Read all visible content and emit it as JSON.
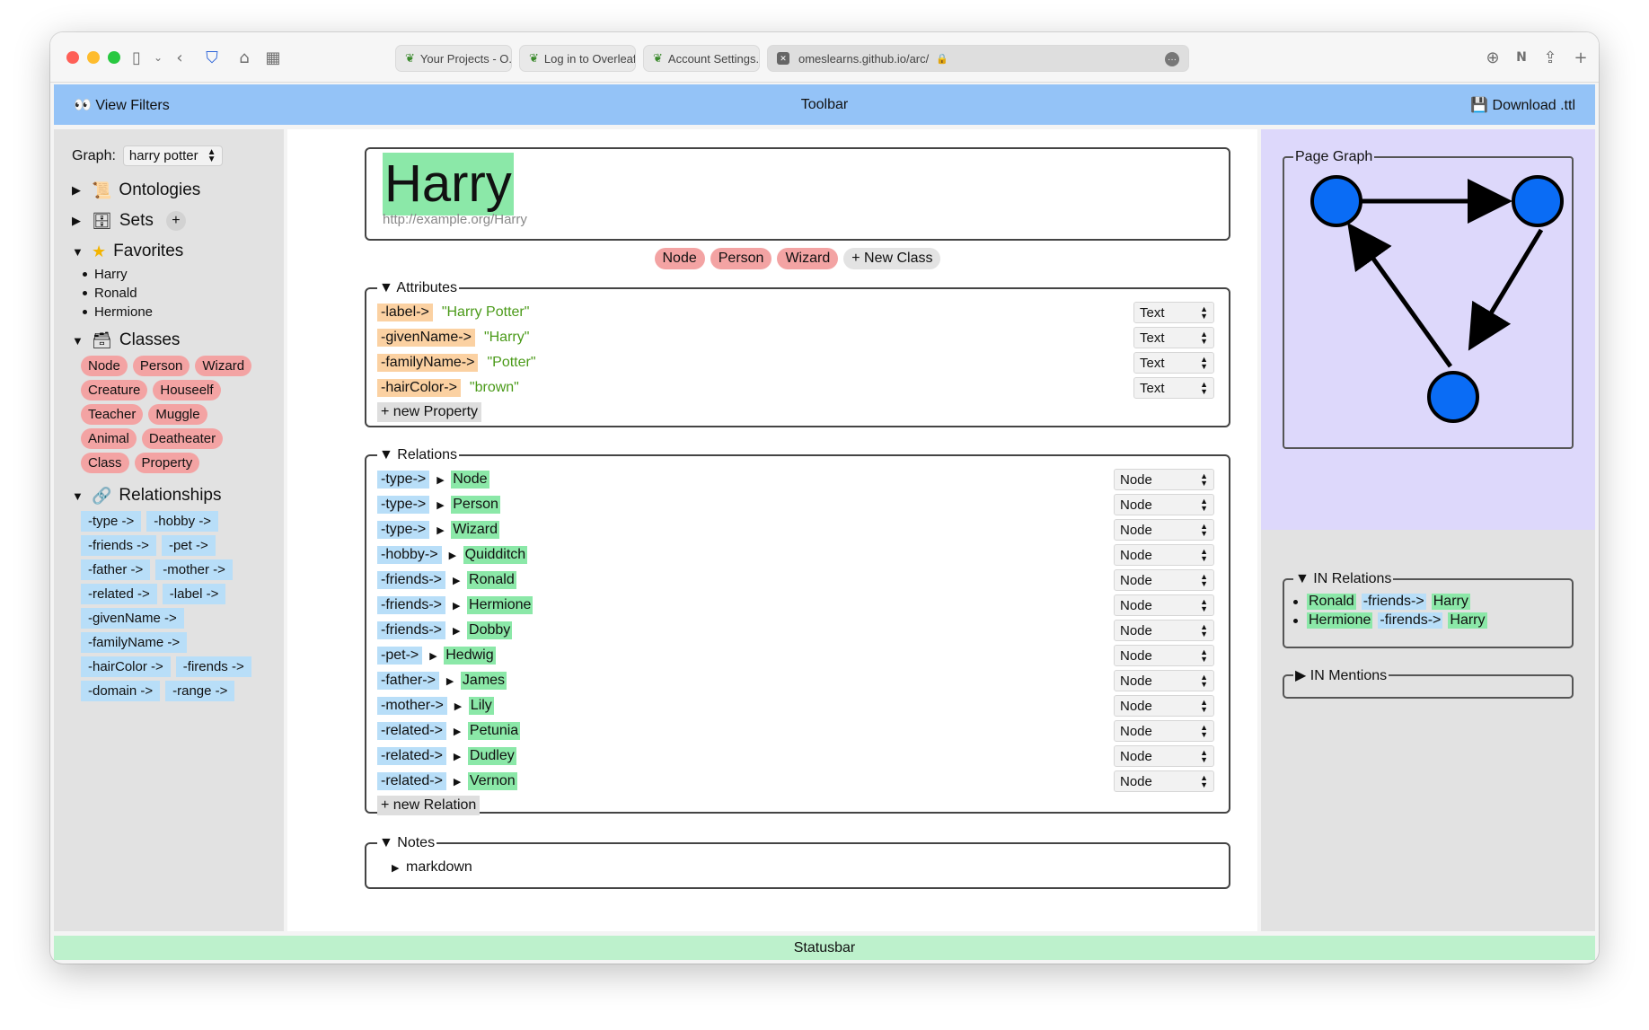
{
  "browser": {
    "tabs": [
      {
        "label": "Your Projects - O..."
      },
      {
        "label": "Log in to Overleaf..."
      },
      {
        "label": "Account Settings..."
      }
    ],
    "active_tab": {
      "url": "omeslearns.github.io/arc/"
    }
  },
  "toolbar": {
    "view_filters": "👀 View Filters",
    "title": "Toolbar",
    "download": "💾 Download .ttl"
  },
  "sidebar": {
    "graph_label": "Graph:",
    "graph_value": "harry potter",
    "ontologies": "Ontologies",
    "sets": "Sets",
    "favorites": "Favorites",
    "favorite_items": [
      "Harry",
      "Ronald",
      "Hermione"
    ],
    "classes": "Classes",
    "class_items": [
      "Node",
      "Person",
      "Wizard",
      "Creature",
      "Houseelf",
      "Teacher",
      "Muggle",
      "Animal",
      "Deatheater",
      "Class",
      "Property"
    ],
    "relationships": "Relationships",
    "relationship_items": [
      "-type ->",
      "-hobby ->",
      "-friends ->",
      "-pet ->",
      "-father ->",
      "-mother ->",
      "-related ->",
      "-label ->",
      "-givenName ->",
      "-familyName ->",
      "-hairColor ->",
      "-firends ->",
      "-domain ->",
      "-range ->"
    ]
  },
  "main": {
    "title": "Harry",
    "uri": "http://example.org/Harry",
    "classes": [
      "Node",
      "Person",
      "Wizard"
    ],
    "new_class": "+ New Class",
    "attributes_legend": "Attributes",
    "attributes": [
      {
        "key": "-label->",
        "value": "\"Harry Potter\"",
        "type": "Text"
      },
      {
        "key": "-givenName->",
        "value": "\"Harry\"",
        "type": "Text"
      },
      {
        "key": "-familyName->",
        "value": "\"Potter\"",
        "type": "Text"
      },
      {
        "key": "-hairColor->",
        "value": "\"brown\"",
        "type": "Text"
      }
    ],
    "new_property": "+ new Property",
    "relations_legend": "Relations",
    "relations": [
      {
        "key": "-type->",
        "target": "Node",
        "type": "Node"
      },
      {
        "key": "-type->",
        "target": "Person",
        "type": "Node"
      },
      {
        "key": "-type->",
        "target": "Wizard",
        "type": "Node"
      },
      {
        "key": "-hobby->",
        "target": "Quidditch",
        "type": "Node"
      },
      {
        "key": "-friends->",
        "target": "Ronald",
        "type": "Node"
      },
      {
        "key": "-friends->",
        "target": "Hermione",
        "type": "Node"
      },
      {
        "key": "-friends->",
        "target": "Dobby",
        "type": "Node"
      },
      {
        "key": "-pet->",
        "target": "Hedwig",
        "type": "Node"
      },
      {
        "key": "-father->",
        "target": "James",
        "type": "Node"
      },
      {
        "key": "-mother->",
        "target": "Lily",
        "type": "Node"
      },
      {
        "key": "-related->",
        "target": "Petunia",
        "type": "Node"
      },
      {
        "key": "-related->",
        "target": "Dudley",
        "type": "Node"
      },
      {
        "key": "-related->",
        "target": "Vernon",
        "type": "Node"
      }
    ],
    "new_relation": "+ new Relation",
    "notes_legend": "Notes",
    "notes_item": "markdown"
  },
  "right": {
    "page_graph": "Page Graph",
    "in_relations": "IN Relations",
    "in_relation_items": [
      {
        "subject": "Ronald",
        "predicate": "-friends->",
        "object": "Harry"
      },
      {
        "subject": "Hermione",
        "predicate": "-firends->",
        "object": "Harry"
      }
    ],
    "in_mentions": "IN Mentions"
  },
  "statusbar": "Statusbar",
  "colors": {
    "toolbar": "#94c3f7",
    "statusbar": "#bdf1cc",
    "graph_bg": "#ddd8fb",
    "node_fill": "#0a6cf5",
    "class_pill": "#f3a3a3",
    "relation_pill": "#b8def8",
    "attribute_pill": "#fbd1a2",
    "target_highlight": "#8be8a8"
  }
}
